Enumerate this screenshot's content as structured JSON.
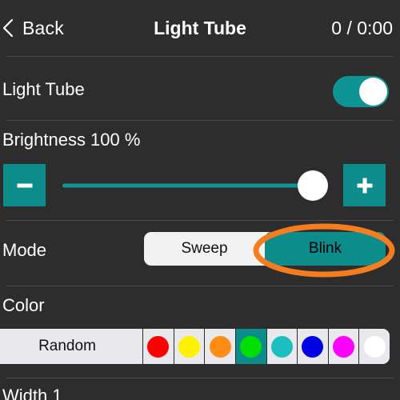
{
  "header": {
    "back_label": "Back",
    "back_icon": "chevron-left-icon",
    "title": "Light Tube",
    "counter": "0 / 0:00"
  },
  "rows": {
    "power": {
      "label": "Light Tube",
      "toggle_on": true
    },
    "brightness": {
      "label": "Brightness 100 %",
      "value_percent": 100,
      "decrement_label": "-",
      "increment_label": "+"
    },
    "mode": {
      "label": "Mode",
      "options": [
        {
          "label": "Sweep",
          "selected": false
        },
        {
          "label": "Blink",
          "selected": true
        }
      ]
    },
    "color": {
      "label": "Color",
      "random_label": "Random",
      "swatches": [
        {
          "name": "red",
          "hex": "#ff0000",
          "selected": false
        },
        {
          "name": "yellow",
          "hex": "#fff200",
          "selected": false
        },
        {
          "name": "orange",
          "hex": "#ff8c14",
          "selected": false
        },
        {
          "name": "green",
          "hex": "#00e000",
          "selected": true
        },
        {
          "name": "cyan",
          "hex": "#1bbfbf",
          "selected": false
        },
        {
          "name": "blue",
          "hex": "#0000e6",
          "selected": false
        },
        {
          "name": "magenta",
          "hex": "#ff00ff",
          "selected": false
        },
        {
          "name": "white",
          "hex": "#ffffff",
          "selected": false
        }
      ]
    },
    "width": {
      "label": "Width 1"
    }
  },
  "theme": {
    "background": "#2d2d2d",
    "accent_teal": "#0d8c8c",
    "annotation_orange": "#f57c1f",
    "divider": "#4b4b4b"
  },
  "annotation": {
    "shape": "ellipse-highlight",
    "target": "Blink"
  }
}
